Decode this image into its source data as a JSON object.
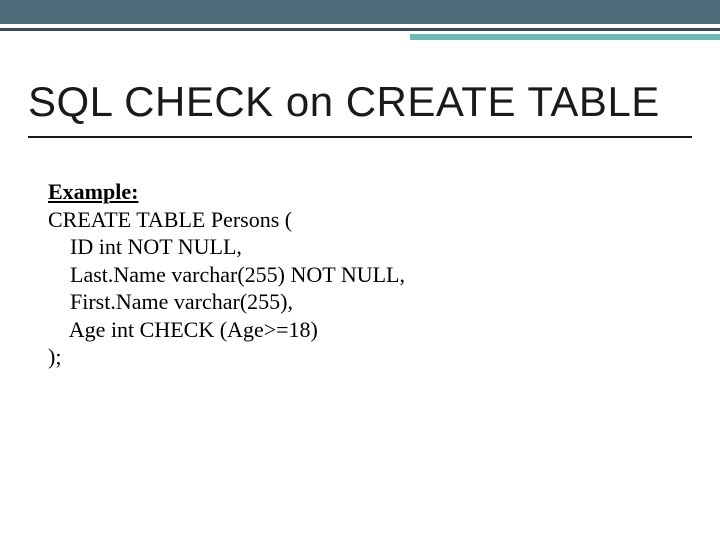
{
  "heading": "SQL CHECK on CREATE TABLE",
  "example_label": "Example:",
  "code": {
    "l1": "CREATE TABLE Persons (",
    "l2": "    ID int NOT NULL,",
    "l3": "    Last.Name varchar(255) NOT NULL,",
    "l4": "    First.Name varchar(255),",
    "l5": "    Age int CHECK (Age>=18)",
    "l6": ");"
  }
}
